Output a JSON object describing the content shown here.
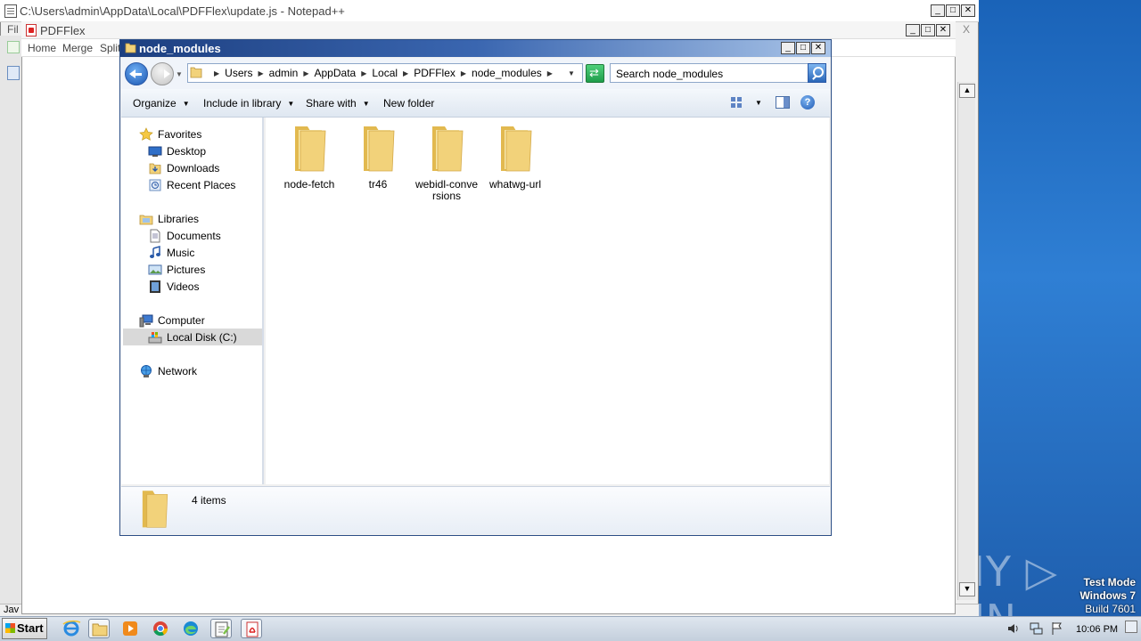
{
  "desktop": {
    "watermark": "ANY ▷ RUN",
    "test_mode": {
      "line1": "Test Mode",
      "line2": "Windows 7",
      "line3": "Build 7601"
    }
  },
  "notepadpp": {
    "title": "C:\\Users\\admin\\AppData\\Local\\PDFFlex\\update.js - Notepad++",
    "menu_fragment": "Fil",
    "status_fragment": "Jav",
    "controls": {
      "minimize": "_",
      "maximize": "□",
      "close": "✕"
    },
    "side_close": "X"
  },
  "pdfflex": {
    "title": "PDFFlex",
    "menu": [
      "Home",
      "Merge",
      "Split"
    ],
    "controls": {
      "minimize": "_",
      "maximize": "□",
      "close": "✕"
    }
  },
  "explorer": {
    "title": "node_modules",
    "controls": {
      "minimize": "_",
      "maximize": "□",
      "close": "✕"
    },
    "breadcrumbs": [
      "Users",
      "admin",
      "AppData",
      "Local",
      "PDFFlex",
      "node_modules"
    ],
    "search": {
      "placeholder": "Search node_modules"
    },
    "commands": {
      "organize": "Organize",
      "include": "Include in library",
      "share": "Share with",
      "new_folder": "New folder"
    },
    "nav": {
      "favorites": "Favorites",
      "desktop": "Desktop",
      "downloads": "Downloads",
      "recent": "Recent Places",
      "libraries": "Libraries",
      "documents": "Documents",
      "music": "Music",
      "pictures": "Pictures",
      "videos": "Videos",
      "computer": "Computer",
      "local_disk": "Local Disk (C:)",
      "network": "Network"
    },
    "files": [
      {
        "name": "node-fetch"
      },
      {
        "name": "tr46"
      },
      {
        "name": "webidl-conversions"
      },
      {
        "name": "whatwg-url"
      }
    ],
    "details": {
      "count": "4 items"
    },
    "help": "?"
  },
  "taskbar": {
    "start": "Start",
    "clock": "10:06 PM",
    "icons": [
      "ie-icon",
      "explorer-icon",
      "media-player-icon",
      "chrome-icon",
      "edge-icon",
      "notepadpp-icon",
      "pdf-icon"
    ]
  },
  "colors": {
    "title_active": "#1d3f80",
    "desktop": "#1f6fc8",
    "folder": "#f2d27a"
  }
}
